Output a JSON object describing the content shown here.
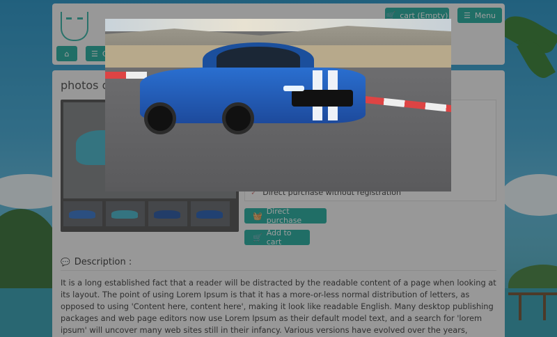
{
  "header": {
    "cart_label": "cart (Empty)",
    "menu_label": "Menu",
    "category_partial": "C"
  },
  "main": {
    "page_title_partial": "photos de",
    "info": {
      "direct_purchase_note": "Direct purchase without registration"
    },
    "buttons": {
      "direct_purchase": "Direct purchase",
      "add_to_cart": "Add to cart"
    },
    "description": {
      "title": "Description :",
      "text": "It is a long established fact that a reader will be distracted by the readable content of a page when looking at its layout. The point of using Lorem Ipsum is that it has a more-or-less normal distribution of letters, as opposed to using 'Content here, content here', making it look like readable English. Many desktop publishing packages and web page editors now use Lorem Ipsum as their default model text, and a search for 'lorem ipsum' will uncover many web sites still in their infancy. Various versions have evolved over the years, sometimes by accident, sometimes on purpose (injected humour"
    },
    "thumbnail_colors": [
      "#2e6fc9",
      "#3fb3c8",
      "#1e4f9e",
      "#1d56b0"
    ]
  },
  "icons": {
    "cart": "cart-icon",
    "menu": "hamburger-icon",
    "home": "home-icon",
    "basket": "basket-icon",
    "comment": "comment-icon"
  },
  "colors": {
    "accent": "#1aa89a",
    "car_blue": "#1d4a9c"
  }
}
